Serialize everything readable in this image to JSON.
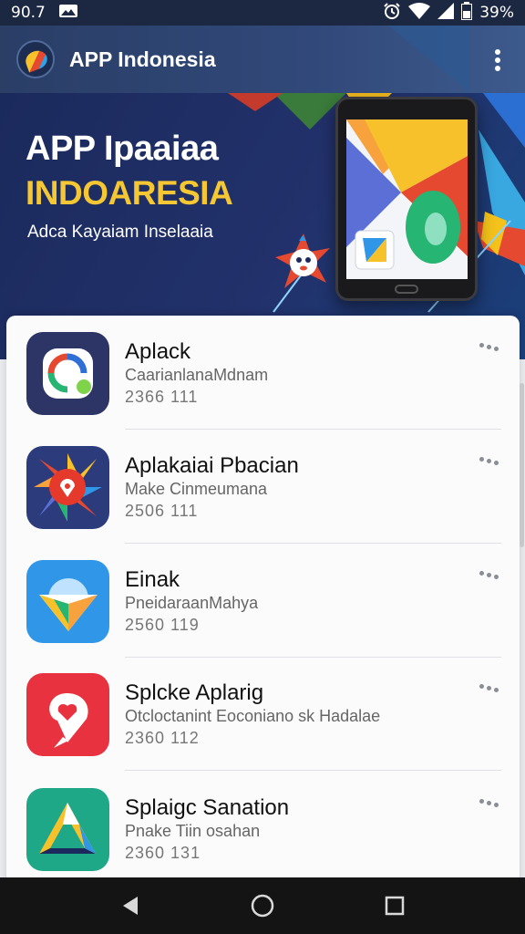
{
  "status_bar": {
    "time": "90.7",
    "battery": "39%",
    "icons": [
      "gallery-icon",
      "alarm-icon",
      "wifi-icon",
      "signal-icon",
      "battery-icon"
    ]
  },
  "app_bar": {
    "title": "APP Indonesia",
    "icons": [
      "app-logo",
      "more-vert-icon"
    ]
  },
  "banner": {
    "title_line1": "APP Ipaaiaa",
    "title_line2": "INDOARESIA",
    "subtitle": "Adca Kayaiam Inselaaia",
    "colors": {
      "title2": "#f4c733",
      "background": "#1b2a5c"
    }
  },
  "apps": [
    {
      "name": "Aplack",
      "description": "CaarianlanaMdnam",
      "meta": "2366 111",
      "icon": "camera-ring-icon",
      "tile_color": "#2c3566"
    },
    {
      "name": "Aplakaiai Pbacian",
      "description": "Make Cinmeumana",
      "meta": "2506 111",
      "icon": "pinwheel-icon",
      "tile_color": "#2b3b7c"
    },
    {
      "name": "Einak",
      "description": "PneidaraanMahya",
      "meta": "2560 119",
      "icon": "paper-plane-icon",
      "tile_color": "#2f96e8"
    },
    {
      "name": "Splcke Aplarig",
      "description": "Otcloctanint Eoconiano sk Hadalae",
      "meta": "2360 112",
      "icon": "heart-pin-icon",
      "tile_color": "#e8323f"
    },
    {
      "name": "Splaigc Sanation",
      "description": "Pnake Tiin osahan",
      "meta": "2360 131",
      "icon": "triangle-logo-icon",
      "tile_color": "#1fa887"
    }
  ],
  "nav_bar": {
    "buttons": [
      "back-icon",
      "home-icon",
      "recents-icon"
    ]
  }
}
